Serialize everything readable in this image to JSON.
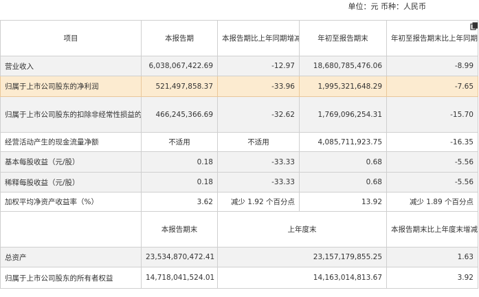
{
  "unit_note": "单位：元 币种：人民币",
  "header1": {
    "item": "项目",
    "current_period": "本报告期",
    "yoy_change": "本报告期比上年同期增减变动幅度(%)",
    "ytd": "年初至报告期末",
    "ytd_change": "年初至报告期末比上年同期增减变动幅度(%)"
  },
  "rows1": [
    {
      "label": "营业收入",
      "c1": "6,038,067,422.69",
      "c2": "-12.97",
      "c3": "18,680,785,476.06",
      "c4": "-8.99"
    },
    {
      "label": "归属于上市公司股东的净利润",
      "c1": "521,497,858.37",
      "c2": "-33.96",
      "c3": "1,995,321,648.29",
      "c4": "-7.65"
    },
    {
      "label": "归属于上市公司股东的扣除非经常性损益的净利润",
      "c1": "466,245,366.69",
      "c2": "-32.62",
      "c3": "1,769,096,254.31",
      "c4": "-15.70"
    },
    {
      "label": "经营活动产生的现金流量净额",
      "c1": "不适用",
      "c2": "不适用",
      "c3": "4,085,711,923.75",
      "c4": "-16.35"
    },
    {
      "label": "基本每股收益（元/股）",
      "c1": "0.18",
      "c2": "-33.33",
      "c3": "0.68",
      "c4": "-5.56"
    },
    {
      "label": "稀释每股收益（元/股）",
      "c1": "0.18",
      "c2": "-33.33",
      "c3": "0.68",
      "c4": "-5.56"
    },
    {
      "label": "加权平均净资产收益率（%）",
      "c1": "3.62",
      "c2": "减少 1.92 个百分点",
      "c3": "13.92",
      "c4": "减少 1.89 个百分点"
    }
  ],
  "header2": {
    "period_end": "本报告期末",
    "last_year_end": "上年度末",
    "change": "本报告期末比上年度末增减变动幅度(%)"
  },
  "rows2": [
    {
      "label": "总资产",
      "c1": "23,534,870,472.41",
      "c2": "23,157,179,855.25",
      "c3": "1.63"
    },
    {
      "label": "归属于上市公司股东的所有者权益",
      "c1": "14,718,041,524.01",
      "c2": "14,163,014,813.67",
      "c3": "3.92"
    }
  ]
}
